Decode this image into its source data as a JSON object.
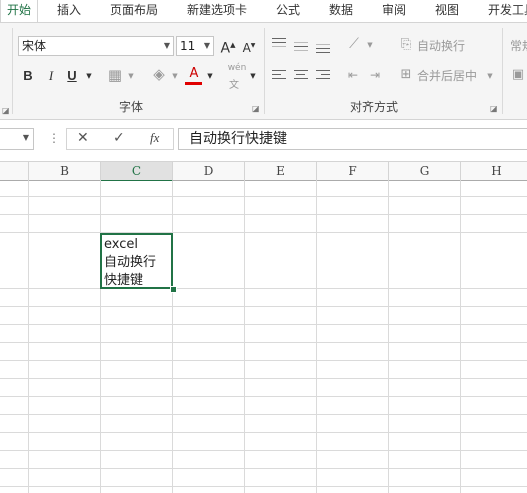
{
  "tabs": [
    {
      "label": "开始",
      "active": true
    },
    {
      "label": "插入"
    },
    {
      "label": "页面布局"
    },
    {
      "label": "新建选项卡"
    },
    {
      "label": "公式"
    },
    {
      "label": "数据"
    },
    {
      "label": "审阅"
    },
    {
      "label": "视图"
    },
    {
      "label": "开发工具"
    }
  ],
  "font_group": {
    "font_name": "宋体",
    "font_size": "11",
    "bold": "B",
    "italic": "I",
    "underline": "U",
    "grow_font": "A",
    "shrink_font": "A",
    "font_color": "A",
    "phonetic": "wén",
    "label": "字体"
  },
  "align_group": {
    "wrap_text": "自动换行",
    "merge_center": "合并后居中",
    "label": "对齐方式"
  },
  "number_group": {
    "format": "常规"
  },
  "formula_bar": {
    "cancel": "✕",
    "enter": "✓",
    "fx": "fx",
    "content": "自动换行快捷键"
  },
  "columns": [
    "B",
    "C",
    "D",
    "E",
    "F",
    "G",
    "H"
  ],
  "selected_column": "C",
  "active_cell": {
    "lines": [
      "excel",
      "自动换行",
      "快捷键"
    ]
  },
  "colors": {
    "accent": "#217346",
    "font_color_bar": "#e00000"
  }
}
